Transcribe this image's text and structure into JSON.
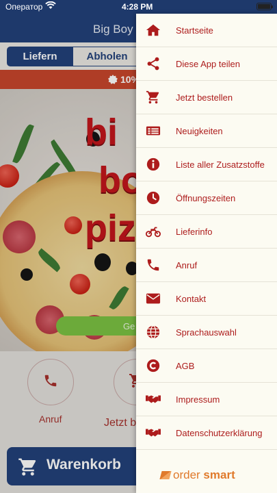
{
  "status_bar": {
    "carrier": "Оператор",
    "time": "4:28 PM"
  },
  "app": {
    "title": "Big Boy P",
    "tabs": [
      {
        "label": "Liefern"
      },
      {
        "label": "Abholen"
      }
    ],
    "promo": "10%",
    "hero_logo_words": [
      "bi",
      "bo",
      "piz"
    ],
    "order_button": "Ge",
    "actions": [
      {
        "label": "Anruf",
        "icon": "phone-icon"
      },
      {
        "label": "Jetzt b",
        "icon": "cart-icon"
      }
    ],
    "cart_label": "Warenkorb"
  },
  "menu": {
    "items": [
      {
        "label": "Startseite",
        "icon": "home-icon"
      },
      {
        "label": "Diese App teilen",
        "icon": "share-icon"
      },
      {
        "label": "Jetzt bestellen",
        "icon": "cart-icon"
      },
      {
        "label": "Neuigkeiten",
        "icon": "news-icon"
      },
      {
        "label": "Liste aller Zusatzstoffe",
        "icon": "info-icon"
      },
      {
        "label": "Öffnungszeiten",
        "icon": "clock-icon"
      },
      {
        "label": "Lieferinfo",
        "icon": "motorcycle-icon"
      },
      {
        "label": "Anruf",
        "icon": "phone-icon"
      },
      {
        "label": "Kontakt",
        "icon": "envelope-icon"
      },
      {
        "label": "Sprachauswahl",
        "icon": "globe-icon"
      },
      {
        "label": "AGB",
        "icon": "copyright-icon"
      },
      {
        "label": "Impressum",
        "icon": "handshake-icon"
      },
      {
        "label": "Datenschutzerklärung",
        "icon": "handshake-icon"
      }
    ]
  },
  "brand": {
    "part1": "order",
    "part2": "smart"
  },
  "colors": {
    "header": "#23417a",
    "accent": "#ad1c1c",
    "promo": "#c8462c",
    "drawer": "#fcfbf2"
  }
}
